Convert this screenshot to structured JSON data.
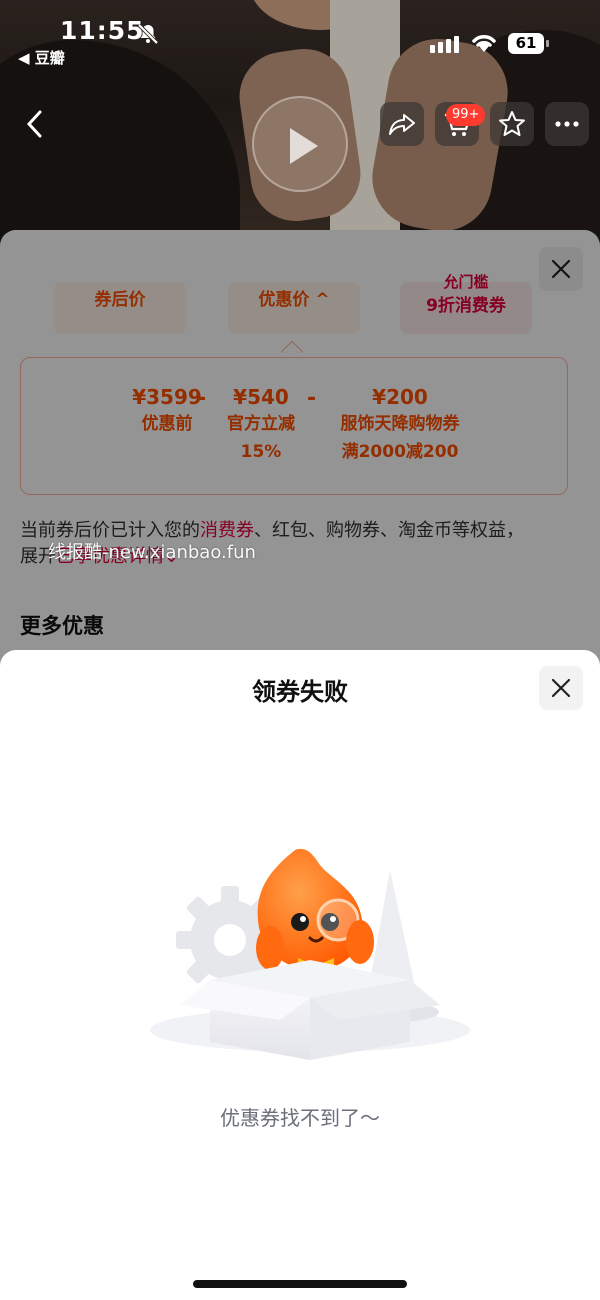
{
  "status_bar": {
    "time": "11:55",
    "back_app": "◀ 豆瓣",
    "battery": "61"
  },
  "hero": {
    "cart_badge": "99+"
  },
  "discount_sheet": {
    "tabs": [
      {
        "label": "券后价"
      },
      {
        "label": "优惠价 ^"
      },
      {
        "top_label_cut": "允门槛",
        "label": "9折消费券"
      }
    ],
    "formula": {
      "items": [
        {
          "value": "¥3599",
          "label": "优惠前",
          "sub": ""
        },
        {
          "value": "¥540",
          "label": "官方立减",
          "sub": "15%"
        },
        {
          "value": "¥200",
          "label": "服饰天降购物券",
          "sub": "满2000减200"
        }
      ],
      "operator": "-"
    },
    "note_prefix": "当前券后价已计入您的",
    "note_highlight": "消费券",
    "note_middle": "、红包、购物券、淘金币等权益，",
    "note_line2_prefix": "展开",
    "note_line2_link": "已享优惠详情",
    "note_line2_arrow": "⌄",
    "watermark": "线报酷-new.xianbao.fun",
    "more_title": "更多优惠"
  },
  "modal": {
    "title": "领券失败",
    "empty_message": "优惠券找不到了～"
  },
  "colors": {
    "accent_orange": "#ff5000",
    "accent_red": "#e8003d",
    "badge_red": "#ff3b30",
    "muted_text": "#6b6f7a"
  },
  "icons": [
    "bell-off-icon",
    "signal-icon",
    "wifi-icon",
    "battery-icon",
    "back-chevron-icon",
    "play-icon",
    "share-icon",
    "cart-icon",
    "star-icon",
    "more-icon",
    "close-icon",
    "mascot-illustration"
  ]
}
